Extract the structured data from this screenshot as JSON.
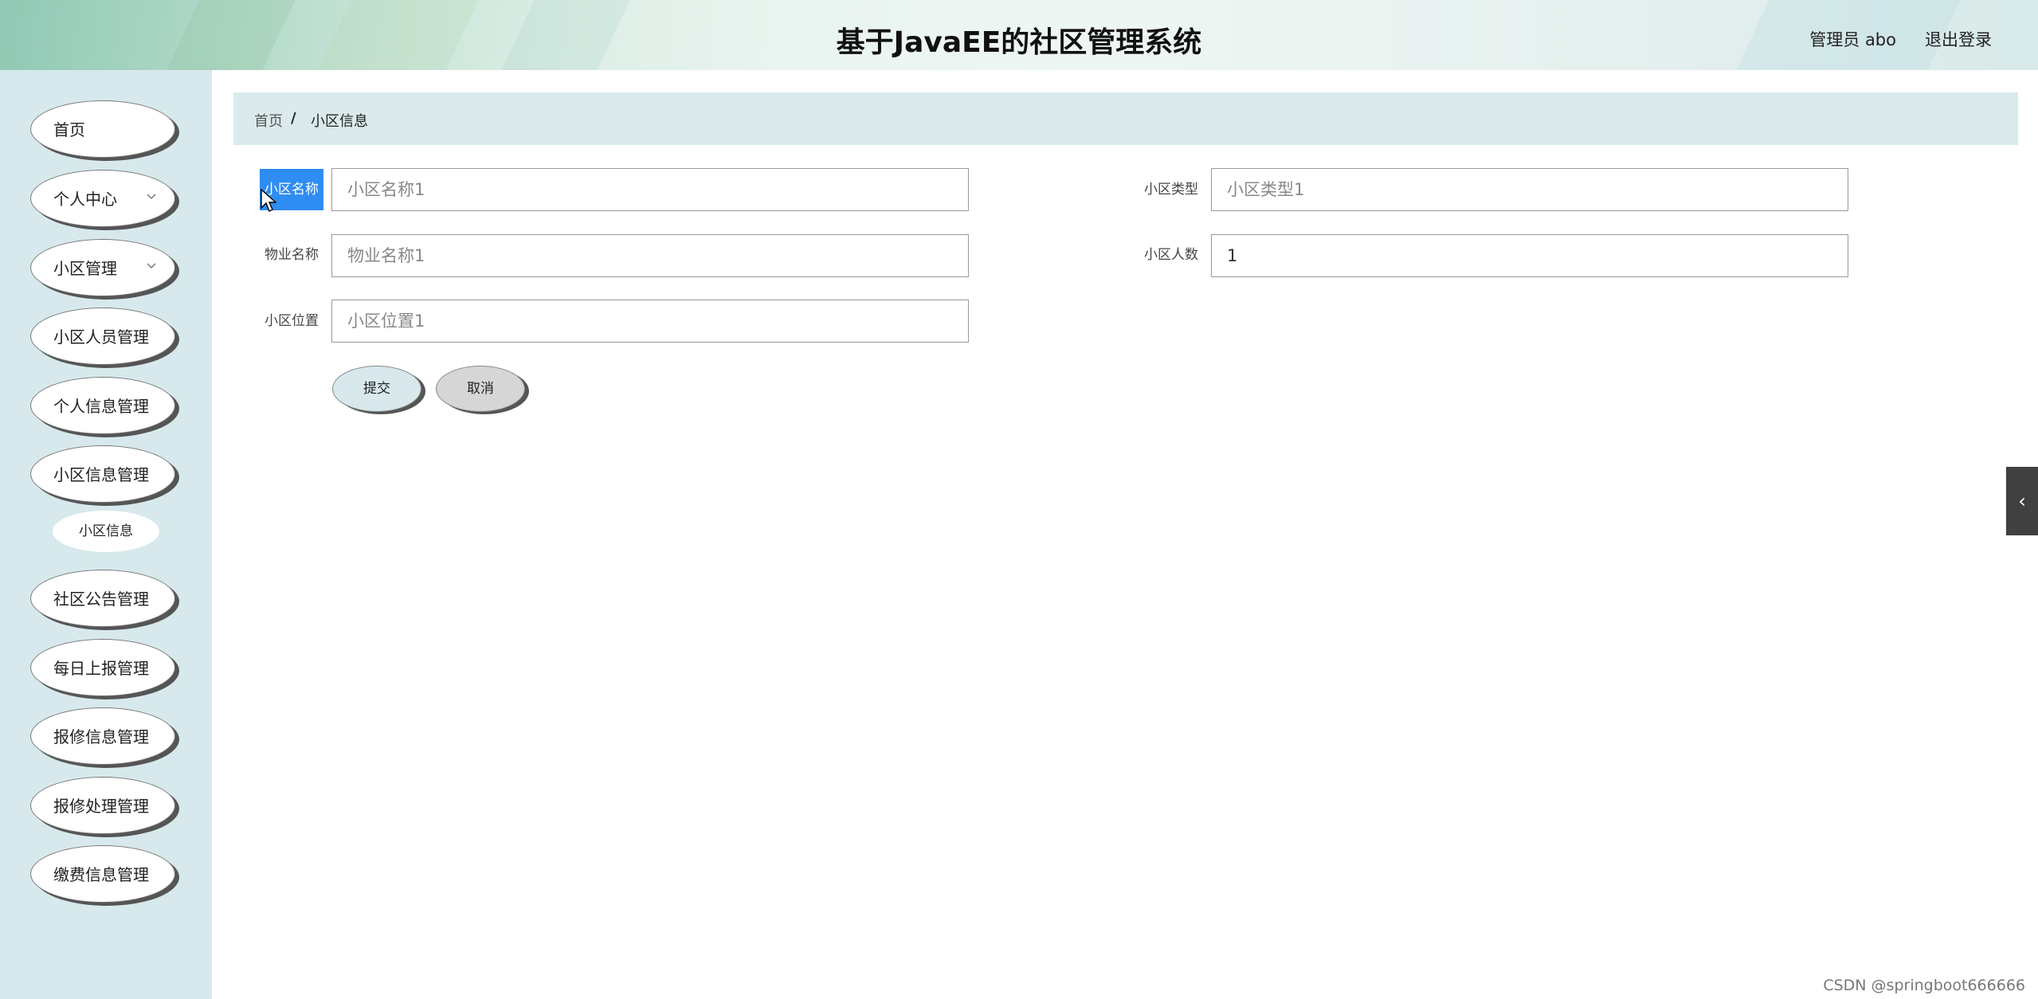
{
  "header": {
    "title": "基于JavaEE的社区管理系统",
    "user": "管理员 abo",
    "logout": "退出登录"
  },
  "sidebar": {
    "items": [
      {
        "label": "首页",
        "has_arrow": false
      },
      {
        "label": "个人中心",
        "has_arrow": true
      },
      {
        "label": "小区管理",
        "has_arrow": true
      },
      {
        "label": "小区人员管理",
        "has_arrow": false
      },
      {
        "label": "个人信息管理",
        "has_arrow": false
      },
      {
        "label": "小区信息管理",
        "has_arrow": false
      },
      {
        "label": "社区公告管理",
        "has_arrow": false
      },
      {
        "label": "每日上报管理",
        "has_arrow": false
      },
      {
        "label": "报修信息管理",
        "has_arrow": false
      },
      {
        "label": "报修处理管理",
        "has_arrow": false
      },
      {
        "label": "缴费信息管理",
        "has_arrow": false
      }
    ],
    "sub_item": {
      "label": "小区信息"
    },
    "arrow_icon": "chevron-down-icon"
  },
  "breadcrumb": {
    "home": "首页",
    "separator": "/",
    "current": "小区信息"
  },
  "form": {
    "fields": {
      "name": {
        "label": "小区名称",
        "value": "",
        "placeholder": "小区名称1"
      },
      "type": {
        "label": "小区类型",
        "value": "",
        "placeholder": "小区类型1"
      },
      "property": {
        "label": "物业名称",
        "value": "",
        "placeholder": "物业名称1"
      },
      "population": {
        "label": "小区人数",
        "value": "1",
        "placeholder": ""
      },
      "location": {
        "label": "小区位置",
        "value": "",
        "placeholder": "小区位置1"
      }
    },
    "submit_label": "提交",
    "cancel_label": "取消"
  },
  "side_toggle": {
    "icon": "chevron-left-icon",
    "glyph": "‹"
  },
  "watermark": "CSDN @springboot666666",
  "colors": {
    "sidebar_bg": "#d7e9ec",
    "breadcrumb_bg": "#dbeaec",
    "highlight": "#2f8cf2",
    "toggle_bg": "#404040"
  }
}
